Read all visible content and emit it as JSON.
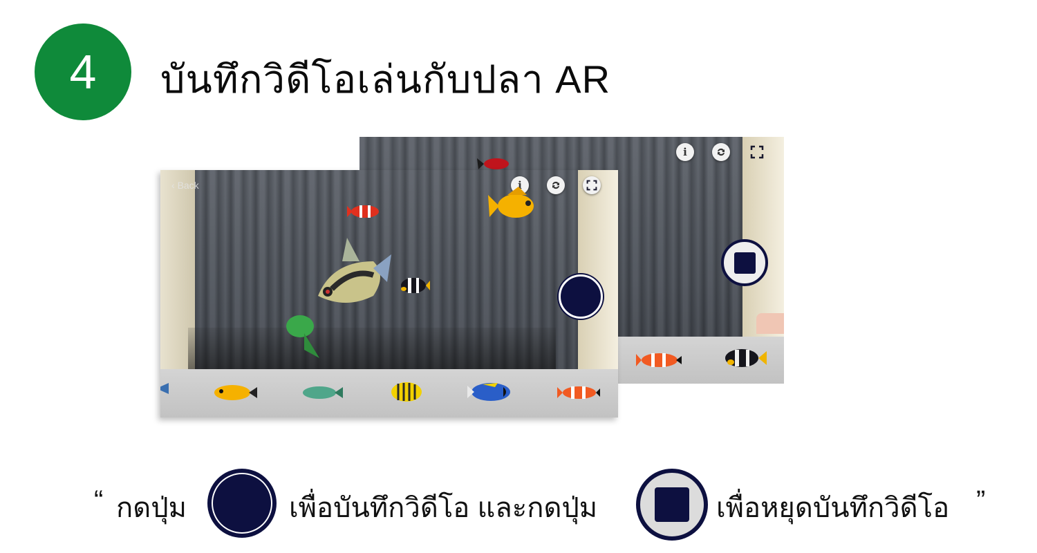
{
  "step": {
    "number": "4"
  },
  "title": "บันทึกวิดีโอเล่นกับปลา AR",
  "screens": {
    "back_label": "Back",
    "info_icon": "info-icon",
    "switch_camera_icon": "switch-camera-icon",
    "fullscreen_icon": "fullscreen-icon",
    "record_button": "record-button",
    "stop_button": "stop-button"
  },
  "fish_tray": {
    "front": [
      "blue-fish",
      "yellow-damselfish",
      "green-wrasse",
      "yellow-butterflyfish",
      "blue-tang",
      "clownfish"
    ],
    "back": [
      "clownfish",
      "black-clownfish"
    ]
  },
  "caption": {
    "open_quote": "“",
    "part1": "กดปุ่ม",
    "part2": "เพื่อบันทึกวิดีโอ และกดปุ่ม",
    "part3": "เพื่อหยุดบันทึกวิดีโอ",
    "close_quote": "”"
  },
  "colors": {
    "badge": "#0f8a3a",
    "button_navy": "#0d1040"
  }
}
